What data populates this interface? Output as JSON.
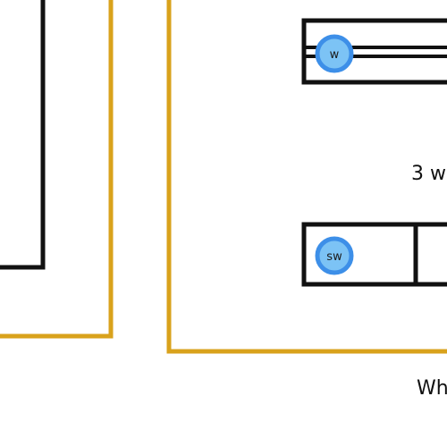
{
  "diagram": {
    "labels": {
      "three_w": "3 w",
      "wh": "Wh"
    },
    "switches": [
      {
        "badge": "w"
      },
      {
        "badge": "sw"
      }
    ],
    "colors": {
      "outline": "#111111",
      "wall": "#D9A21C",
      "switch_ring": "#3D8FE8",
      "switch_fill": "#7CC3F5"
    }
  }
}
